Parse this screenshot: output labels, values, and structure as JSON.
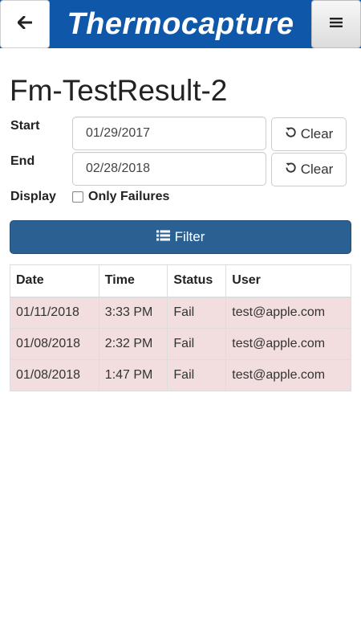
{
  "header": {
    "app_title": "Thermocapture",
    "back_icon": "arrow-left-icon",
    "menu_icon": "hamburger-menu-icon",
    "brand_color": "#0f57a8"
  },
  "page": {
    "title": "Fm-TestResult-2"
  },
  "filters": {
    "start_label": "Start",
    "start_value": "01/29/2017",
    "end_label": "End",
    "end_value": "02/28/2018",
    "clear_label": "Clear",
    "display_label": "Display",
    "only_failures_label": "Only Failures",
    "only_failures_checked": false,
    "filter_button_label": "Filter"
  },
  "table": {
    "columns": [
      "Date",
      "Time",
      "Status",
      "User"
    ],
    "rows": [
      [
        "01/11/2018",
        "3:33 PM",
        "Fail",
        "test@apple.com"
      ],
      [
        "01/08/2018",
        "2:32 PM",
        "Fail",
        "test@apple.com"
      ],
      [
        "01/08/2018",
        "1:47 PM",
        "Fail",
        "test@apple.com"
      ]
    ],
    "failure_row_color": "#f2dede"
  }
}
